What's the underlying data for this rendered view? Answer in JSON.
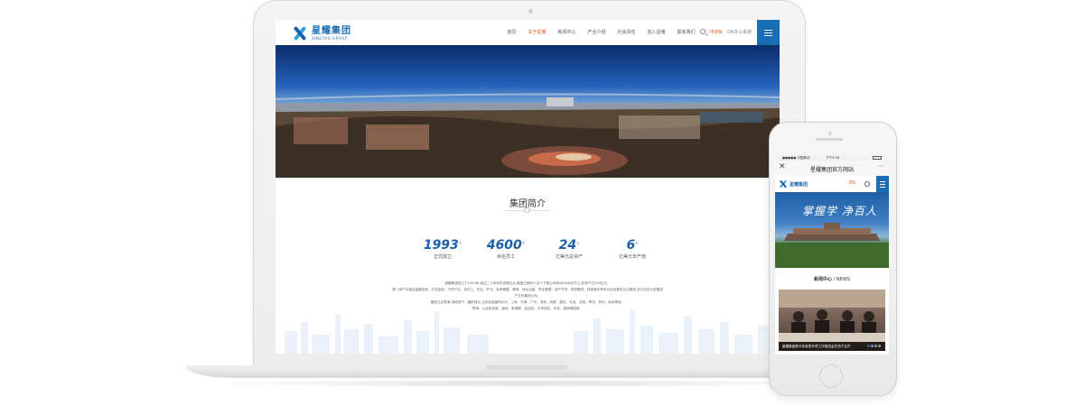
{
  "desktop": {
    "logo": {
      "cn": "星耀集团",
      "en": "XINGYAO GROUP"
    },
    "nav": [
      "首页",
      "关于星耀",
      "新闻中心",
      "产业介绍",
      "社会责任",
      "加入星耀",
      "联系我们"
    ],
    "nav_active_index": 1,
    "lang": "中/EN",
    "oa": "OA办公系统",
    "intro": {
      "title": "集团简介",
      "stats": [
        {
          "num": "1993",
          "label": "正式成立"
        },
        {
          "num": "4600",
          "label": "余名员工"
        },
        {
          "num": "24",
          "label": "亿美元总资产"
        },
        {
          "num": "6",
          "label": "亿美元年产值"
        }
      ],
      "paragraph": [
        "星耀集团创立于1993年,经过二十多年的发展壮大,集团已拥有十余个下属公司和4600余名员工,总资产达200亿元。",
        "是一家产业遍及金融投资、文化旅游、汽车产业、化纤工、农业、矿业、医养健康、教育、商业运营、物业管理、地产开发、债券融资、体育娱乐等多元化经营的企业集团,多元化的大型集团",
        "产业化集团公司。",
        "集团立足青海,深耕西宁、辐射西北,业务足迹遍布北京、上海、天津、广州、深圳、成都、重庆、大连、沈阳、青岛、杭州、南京等地。",
        "青海、以及新加坡、缅甸、柬埔寨、孟加拉、马来西亚、印尼、越南等国家。"
      ]
    }
  },
  "mobile": {
    "status": {
      "carrier": "●●●●● 中国移动",
      "time": "下午3:56"
    },
    "wx_title": "星耀集团官方网站",
    "logo_cn": "星耀集团",
    "lang": "EN",
    "banner": {
      "text": "掌握学 净百人",
      "sub": ""
    },
    "news": {
      "title": "新闻中心",
      "title_en": "/ NEWS",
      "caption": "星耀集团数字化转型专项工作推进会在西宁召开"
    }
  }
}
